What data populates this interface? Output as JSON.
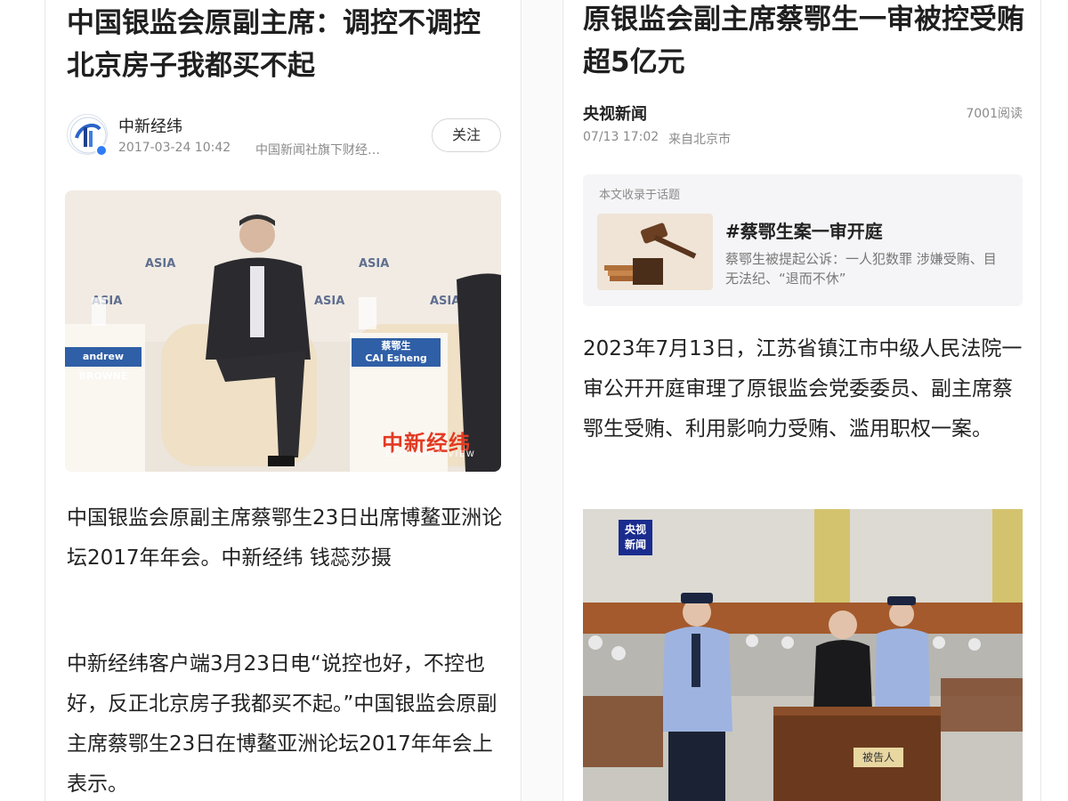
{
  "left_article": {
    "title": "中国银监会原副主席：调控不调控北京房子我都买不起",
    "author": {
      "name": "中新经纬",
      "date": "2017-03-24 10:42",
      "org": "中国新闻社旗下财经…",
      "avatar_icon": "cns-logo-icon"
    },
    "follow_label": "关注",
    "photo": {
      "name_card_left": "andrew BROWNE",
      "name_card_right_cn": "蔡鄂生",
      "name_card_right_en": "CAI Esheng",
      "watermark": "中新经纬",
      "watermark_sub": "ECONOMIC VIEW",
      "backdrop_text": "ASIA"
    },
    "paragraph_1": "中国银监会原副主席蔡鄂生23日出席博鳌亚洲论坛2017年年会。中新经纬 钱蕊莎摄",
    "paragraph_2": "中新经纬客户端3月23日电“说控也好，不控也好，反正北京房子我都买不起。”中国银监会原副主席蔡鄂生23日在博鳌亚洲论坛2017年年会上表示。"
  },
  "right_article": {
    "title": "原银监会副主席蔡鄂生一审被控受贿超5亿元",
    "source": "央视新闻",
    "read_count": "7001阅读",
    "date": "07/13 17:02",
    "location": "来自北京市",
    "topic": {
      "label": "本文收录于话题",
      "title": "#蔡鄂生案一审开庭",
      "description": "蔡鄂生被提起公诉：一人犯数罪 涉嫌受贿、目无法纪、“退而不休”",
      "thumb_icon": "gavel-icon"
    },
    "paragraph_1": "2023年7月13日，江苏省镇江市中级人民法院一审公开开庭审理了原银监会党委委员、副主席蔡鄂生受贿、利用影响力受贿、滥用职权一案。",
    "photo": {
      "logo_line1": "央视",
      "logo_line2": "新闻",
      "dock_label": "被告人"
    }
  },
  "colors": {
    "page_bg": "#ffffff",
    "title": "#1f1f1f",
    "meta": "#8a8a8a",
    "topic_card_bg": "#f5f5f7",
    "watermark_red": "#e23a22",
    "cctv_blue": "#1a2c8e"
  }
}
